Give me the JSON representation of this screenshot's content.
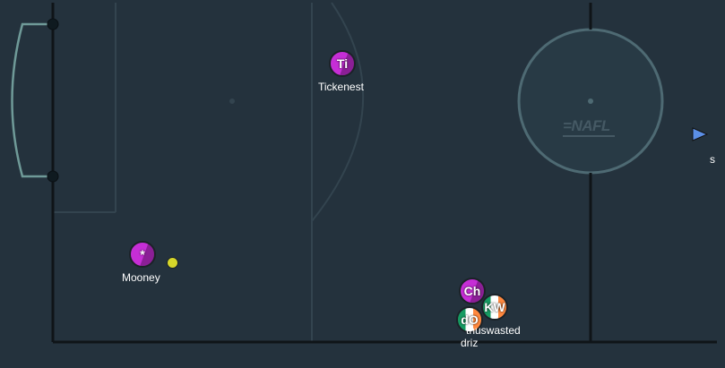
{
  "pitch": {
    "colors": {
      "background": "#24323d",
      "line": "#0f1418",
      "faint_line": "#33444f",
      "goal": "#6f9a98",
      "circle": "#4e6a73"
    }
  },
  "logo": {
    "text": "NAFL",
    "dash": "="
  },
  "players": [
    {
      "initials": "Ti",
      "name": "Tickenest",
      "team": "purple"
    },
    {
      "initials": "*",
      "name": "Mooney",
      "team": "purple"
    },
    {
      "initials": "Ch",
      "name": "",
      "team": "purple"
    },
    {
      "initials": "KW",
      "name": "thuswasted",
      "team": "ireland"
    },
    {
      "initials": "dO",
      "name": "driz",
      "team": "ireland"
    }
  ],
  "ball": {
    "color": "#d7d72a"
  },
  "side_marker": {
    "icon": "play-arrow-icon",
    "label": "s"
  }
}
